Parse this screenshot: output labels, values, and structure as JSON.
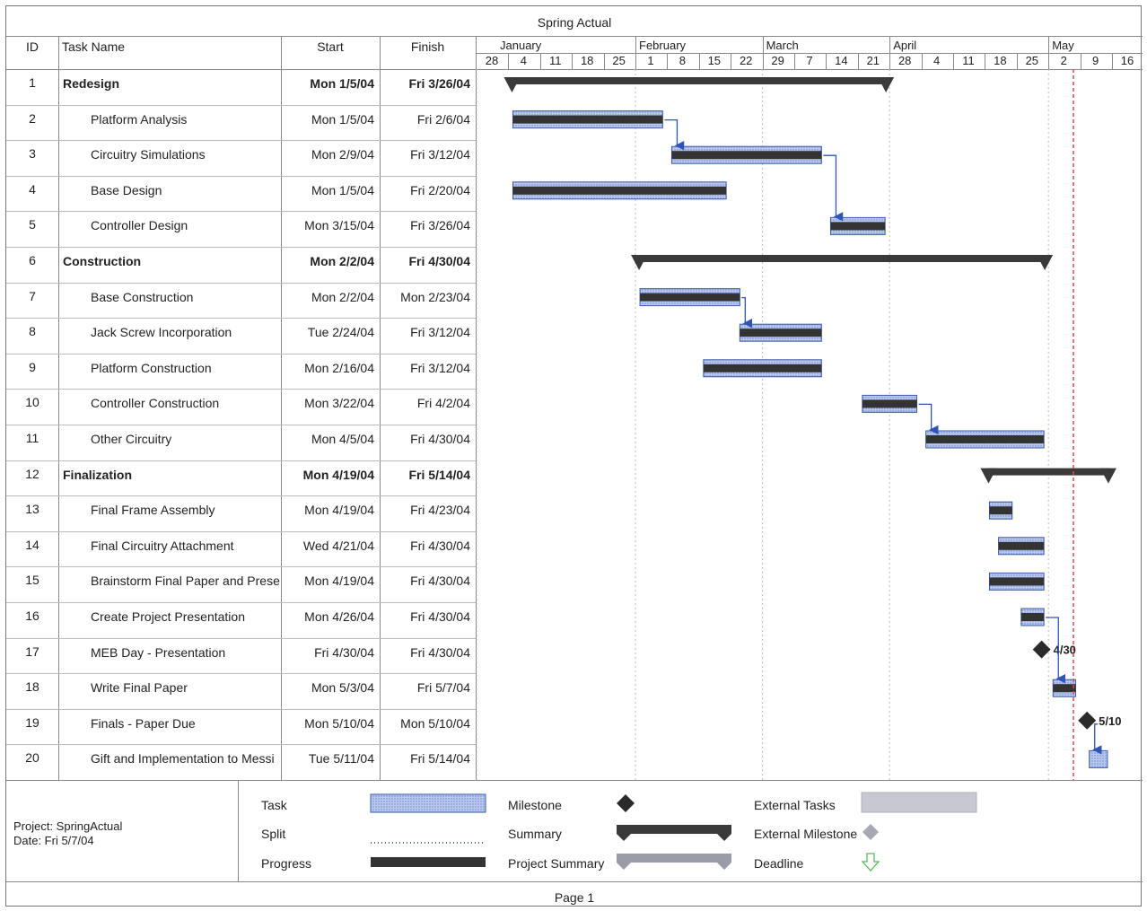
{
  "title": "Spring Actual",
  "columns": {
    "id": "ID",
    "task_name": "Task Name",
    "start": "Start",
    "finish": "Finish"
  },
  "timescale": {
    "months": [
      "January",
      "February",
      "March",
      "April",
      "May"
    ],
    "days": [
      "28",
      "4",
      "11",
      "18",
      "25",
      "1",
      "8",
      "15",
      "22",
      "29",
      "7",
      "14",
      "21",
      "28",
      "4",
      "11",
      "18",
      "25",
      "2",
      "9",
      "16"
    ]
  },
  "chart_data": {
    "type": "gantt",
    "title": "Spring Actual",
    "x_range": [
      "2003-12-28",
      "2004-05-23"
    ],
    "status_date": "2004-05-07",
    "tasks": [
      {
        "id": "1",
        "name": "Redesign",
        "start": "Mon 1/5/04",
        "finish": "Fri 3/26/04",
        "s": "2004-01-05",
        "f": "2004-03-26",
        "summary": true
      },
      {
        "id": "2",
        "name": "Platform Analysis",
        "start": "Mon 1/5/04",
        "finish": "Fri 2/6/04",
        "s": "2004-01-05",
        "f": "2004-02-06",
        "summary": false
      },
      {
        "id": "3",
        "name": "Circuitry Simulations",
        "start": "Mon 2/9/04",
        "finish": "Fri 3/12/04",
        "s": "2004-02-09",
        "f": "2004-03-12",
        "summary": false
      },
      {
        "id": "4",
        "name": "Base Design",
        "start": "Mon 1/5/04",
        "finish": "Fri 2/20/04",
        "s": "2004-01-05",
        "f": "2004-02-20",
        "summary": false
      },
      {
        "id": "5",
        "name": "Controller Design",
        "start": "Mon 3/15/04",
        "finish": "Fri 3/26/04",
        "s": "2004-03-15",
        "f": "2004-03-26",
        "summary": false
      },
      {
        "id": "6",
        "name": "Construction",
        "start": "Mon 2/2/04",
        "finish": "Fri 4/30/04",
        "s": "2004-02-02",
        "f": "2004-04-30",
        "summary": true
      },
      {
        "id": "7",
        "name": "Base Construction",
        "start": "Mon 2/2/04",
        "finish": "Mon 2/23/04",
        "s": "2004-02-02",
        "f": "2004-02-23",
        "summary": false
      },
      {
        "id": "8",
        "name": "Jack Screw Incorporation",
        "start": "Tue 2/24/04",
        "finish": "Fri 3/12/04",
        "s": "2004-02-24",
        "f": "2004-03-12",
        "summary": false
      },
      {
        "id": "9",
        "name": "Platform Construction",
        "start": "Mon 2/16/04",
        "finish": "Fri 3/12/04",
        "s": "2004-02-16",
        "f": "2004-03-12",
        "summary": false
      },
      {
        "id": "10",
        "name": "Controller Construction",
        "start": "Mon 3/22/04",
        "finish": "Fri 4/2/04",
        "s": "2004-03-22",
        "f": "2004-04-02",
        "summary": false
      },
      {
        "id": "11",
        "name": "Other Circuitry",
        "start": "Mon 4/5/04",
        "finish": "Fri 4/30/04",
        "s": "2004-04-05",
        "f": "2004-04-30",
        "summary": false
      },
      {
        "id": "12",
        "name": "Finalization",
        "start": "Mon 4/19/04",
        "finish": "Fri 5/14/04",
        "s": "2004-04-19",
        "f": "2004-05-14",
        "summary": true
      },
      {
        "id": "13",
        "name": "Final Frame Assembly",
        "start": "Mon 4/19/04",
        "finish": "Fri 4/23/04",
        "s": "2004-04-19",
        "f": "2004-04-23",
        "summary": false
      },
      {
        "id": "14",
        "name": "Final Circuitry Attachment",
        "start": "Wed 4/21/04",
        "finish": "Fri 4/30/04",
        "s": "2004-04-21",
        "f": "2004-04-30",
        "summary": false
      },
      {
        "id": "15",
        "name": "Brainstorm Final Paper and Prese",
        "start": "Mon 4/19/04",
        "finish": "Fri 4/30/04",
        "s": "2004-04-19",
        "f": "2004-04-30",
        "summary": false
      },
      {
        "id": "16",
        "name": "Create Project Presentation",
        "start": "Mon 4/26/04",
        "finish": "Fri 4/30/04",
        "s": "2004-04-26",
        "f": "2004-04-30",
        "summary": false
      },
      {
        "id": "17",
        "name": "MEB Day - Presentation",
        "start": "Fri 4/30/04",
        "finish": "Fri 4/30/04",
        "s": "2004-04-30",
        "f": "2004-04-30",
        "milestone": true,
        "label": "4/30"
      },
      {
        "id": "18",
        "name": "Write Final Paper",
        "start": "Mon 5/3/04",
        "finish": "Fri 5/7/04",
        "s": "2004-05-03",
        "f": "2004-05-07",
        "summary": false
      },
      {
        "id": "19",
        "name": "Finals - Paper Due",
        "start": "Mon 5/10/04",
        "finish": "Mon 5/10/04",
        "s": "2004-05-10",
        "f": "2004-05-10",
        "milestone": true,
        "label": "5/10"
      },
      {
        "id": "20",
        "name": "Gift and Implementation  to Messi",
        "start": "Tue 5/11/04",
        "finish": "Fri 5/14/04",
        "s": "2004-05-11",
        "f": "2004-05-14",
        "summary": false,
        "progress": 0
      }
    ],
    "dependencies": [
      [
        2,
        3
      ],
      [
        3,
        5
      ],
      [
        7,
        8
      ],
      [
        10,
        11
      ],
      [
        16,
        18
      ],
      [
        19,
        20
      ]
    ]
  },
  "legend": {
    "col1": [
      "Task",
      "Split",
      "Progress"
    ],
    "col2": [
      "Milestone",
      "Summary",
      "Project Summary"
    ],
    "col3": [
      "External Tasks",
      "External Milestone",
      "Deadline"
    ]
  },
  "footer": {
    "project": "Project: SpringActual",
    "date": "Date: Fri 5/7/04",
    "page": "Page 1"
  },
  "colors": {
    "task_fill": "#b9c8ee",
    "task_border": "#3b5aa8",
    "progress": "#333333",
    "summary": "#3a3a3a",
    "arrow": "#2f54b5",
    "status_line": "#e04848",
    "external": "#c8c8d2"
  }
}
